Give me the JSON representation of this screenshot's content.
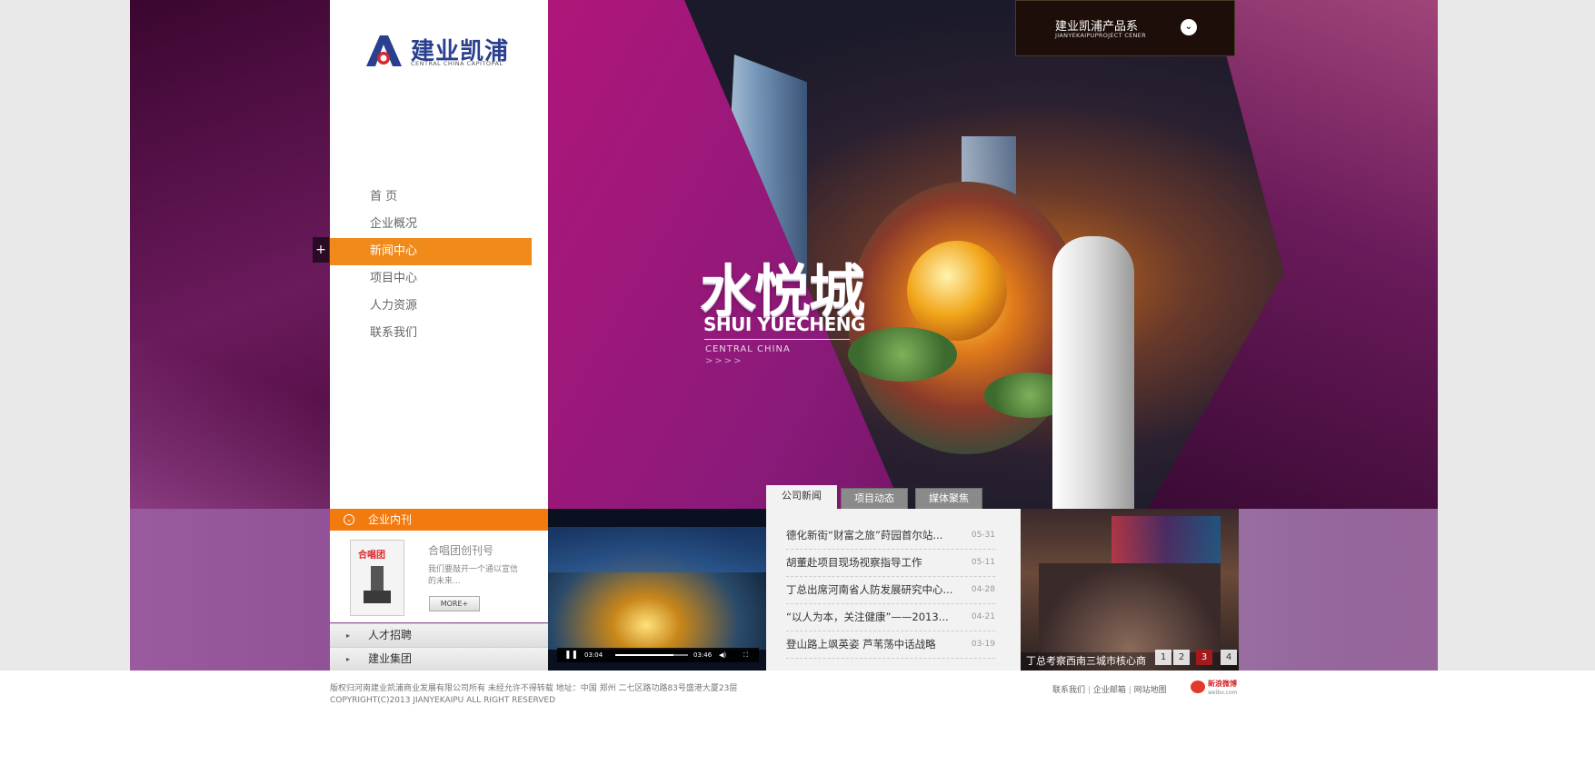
{
  "logo": {
    "name": "建业凯浦",
    "sub": "CENTRAL CHINA CAPITOPAL"
  },
  "nav": {
    "plus": "+",
    "items": [
      "首 页",
      "企业概况",
      "新闻中心",
      "项目中心",
      "人力资源",
      "联系我们"
    ]
  },
  "product_system": {
    "title": "建业凯浦产品系",
    "sub": "JIANYEKAIPUPROJECT CENER",
    "icon": "chevron-down-icon"
  },
  "hero": {
    "title": "水悦城",
    "subtitle": "SHUI YUECHENG",
    "tag": "CENTRAL  CHINA",
    "arrows": ">>>>"
  },
  "inner_site": {
    "header": "企业内刊",
    "magazine_cover": "合唱团",
    "title": "合唱团创刊号",
    "desc": "我们要敲开一个通以宣信的未来...",
    "more": "MORE+"
  },
  "accordion": [
    {
      "label": "人才招聘"
    },
    {
      "label": "建业集团"
    }
  ],
  "video": {
    "time_current": "03:04",
    "time_total": "03:46",
    "progress": 0.8
  },
  "news": {
    "tabs": [
      "公司新闻",
      "项目动态",
      "媒体聚焦"
    ],
    "items": [
      {
        "title": "德化新街“财富之旅”莳园首尔站...",
        "date": "05-31"
      },
      {
        "title": "胡董赴项目现场视察指导工作",
        "date": "05-11"
      },
      {
        "title": "丁总出席河南省人防发展研究中心...",
        "date": "04-28"
      },
      {
        "title": "“以人为本，关注健康”——2013...",
        "date": "04-21"
      },
      {
        "title": "登山路上飒英姿  芦苇荡中话战略",
        "date": "03-19"
      }
    ]
  },
  "photo": {
    "caption": "丁总考察西南三城市核心商",
    "pages": [
      "1",
      "2",
      "3",
      "4"
    ],
    "active_page": 3
  },
  "footer": {
    "line1": "版权归河南建业凯浦商业发展有限公司所有  未经允许不得转载  地址：中国 郑州 二七区路功路83号盛港大厦23层",
    "line2": "COPYRIGHT(C)2013 JIANYEKAIPU ALL RIGHT RESERVED",
    "links": [
      "联系我们",
      "企业邮箱",
      "网站地图"
    ],
    "separator": "|",
    "weibo": "新浪微博",
    "weibo_sub": "weibo.com"
  },
  "colors": {
    "accent": "#f27a0e",
    "brand": "#2b3f8f",
    "page_active": "#a01a1e"
  }
}
